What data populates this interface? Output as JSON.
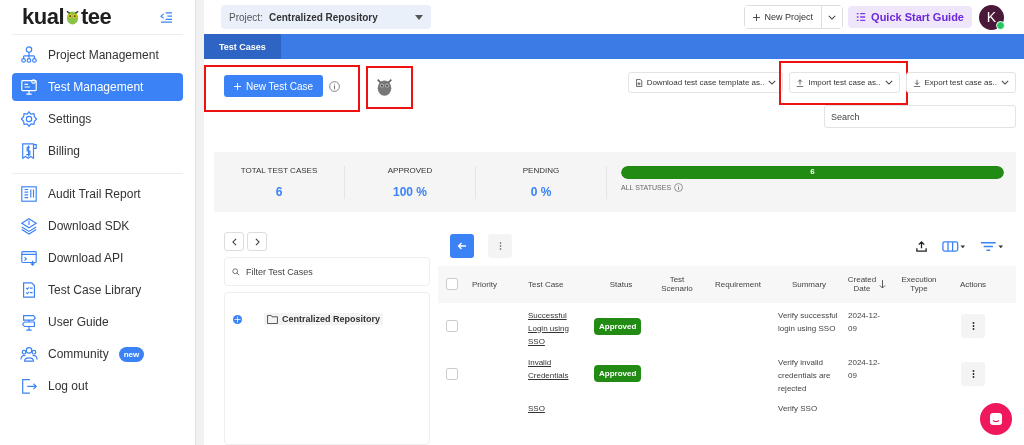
{
  "sidebar": {
    "logo": {
      "left": "kual",
      "right": "tee"
    },
    "groups": [
      [
        {
          "label": "Project Management",
          "selected": false
        },
        {
          "label": "Test Management",
          "selected": true
        },
        {
          "label": "Settings",
          "selected": false
        },
        {
          "label": "Billing",
          "selected": false
        }
      ],
      [
        {
          "label": "Audit Trail Report",
          "selected": false
        },
        {
          "label": "Download SDK",
          "selected": false
        },
        {
          "label": "Download API",
          "selected": false
        },
        {
          "label": "Test Case Library",
          "selected": false
        },
        {
          "label": "User Guide",
          "selected": false
        },
        {
          "label": "Community",
          "selected": false,
          "badge": "new"
        },
        {
          "label": "Log out",
          "selected": false
        }
      ]
    ]
  },
  "topbar": {
    "project_label": "Project:",
    "project_name": "Centralized Repository",
    "new_project": "New Project",
    "quick_start": "Quick Start Guide",
    "avatar": "K"
  },
  "tabs": [
    {
      "label": "Test Cases",
      "selected": true
    }
  ],
  "toolbar": {
    "new_test_case": "New Test Case",
    "menus": [
      "Download test case template as..",
      "Import test case as..",
      "Export test case as.."
    ],
    "search": {
      "placeholder": "Search"
    }
  },
  "stats": [
    {
      "label": "TOTAL TEST CASES",
      "value": "6"
    },
    {
      "label": "APPROVED",
      "value": "100 %"
    },
    {
      "label": "PENDING",
      "value": "0 %"
    }
  ],
  "progress": {
    "level": 1,
    "count": "6",
    "label": "ALL STATUSES"
  },
  "tree": {
    "filter": {
      "placeholder": "Filter Test Cases"
    },
    "root": "Centralized Repository"
  },
  "table": {
    "all_checked": false,
    "columns": [
      "Priority",
      "Test Case",
      "Status",
      "Test Scenario",
      "Requirement",
      "Summary",
      "Created Date",
      "Execution Type",
      "Actions"
    ],
    "rows": [
      {
        "checked": false,
        "test_case": "Successful Login using SSO",
        "status": "Approved",
        "summary": "Verify successful login using SSO",
        "created_date": "2024-12-09"
      },
      {
        "checked": false,
        "test_case": "Invalid Credentials",
        "status": "Approved",
        "summary": "Verify invalid credentials are rejected",
        "created_date": "2024-12-09"
      },
      {
        "test_case": "SSO",
        "summary": "Verify SSO"
      }
    ]
  }
}
